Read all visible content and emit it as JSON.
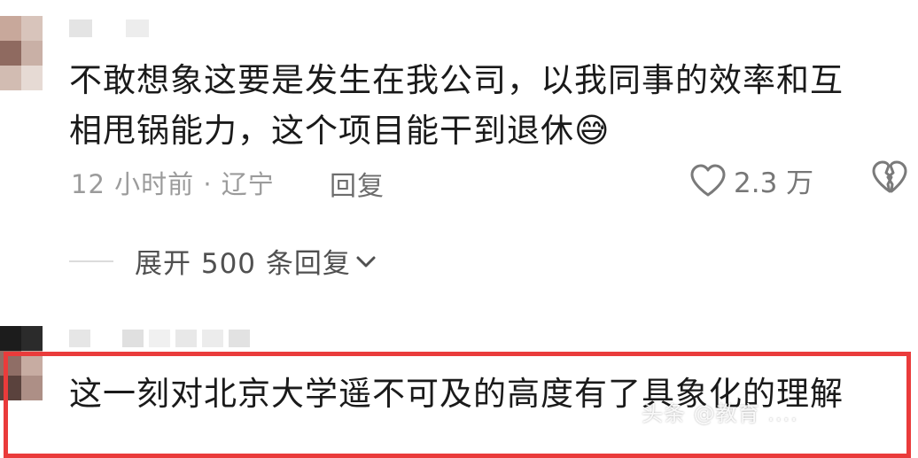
{
  "comment1": {
    "text_line1": "不敢想象这要是发生在我公司，以我同事的效率和互",
    "text_line2": "相甩锅能力，这个项目能干到退休",
    "emoji": "😅",
    "time_location": "12 小时前 · 辽宁",
    "reply_label": "回复",
    "like_count": "2.3 万"
  },
  "expand_replies": {
    "label": "展开 500 条回复",
    "chevron": "chevron-down-icon"
  },
  "comment2": {
    "text": "这一刻对北京大学遥不可及的高度有了具象化的理解"
  },
  "watermark": "头条 @教育 ....",
  "colors": {
    "highlight": "#ea3b3b",
    "meta": "#9b9b9b",
    "text": "#1a1a1a"
  }
}
